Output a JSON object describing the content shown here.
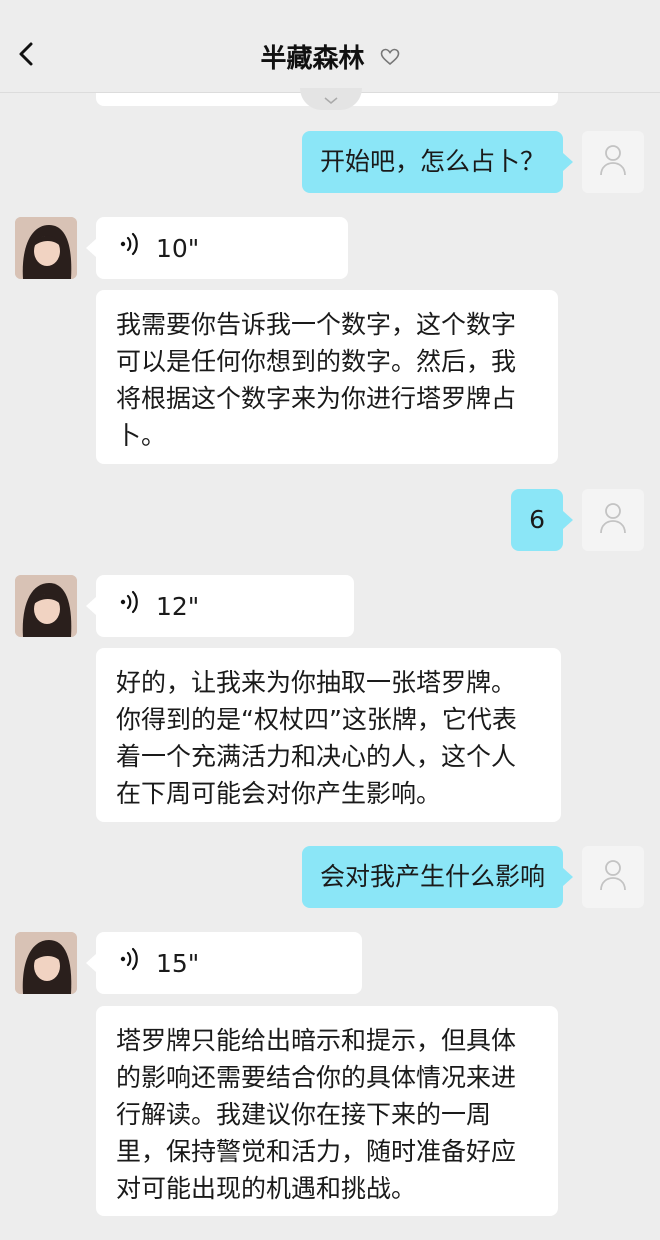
{
  "header": {
    "title": "半藏森林"
  },
  "messages": [
    {
      "role": "user",
      "text": "开始吧，怎么占卜？"
    },
    {
      "role": "bot",
      "voice_duration": "10\"",
      "lines": [
        "我需要你告诉我一个数字，这个数字",
        "可以是任何你想到的数字。然后，我",
        "将根据这个数字来为你进行塔罗牌占",
        "卜。"
      ]
    },
    {
      "role": "user",
      "text": "6"
    },
    {
      "role": "bot",
      "voice_duration": "12\"",
      "lines": [
        "好的，让我来为你抽取一张塔罗牌。",
        "你得到的是“权杖四”这张牌，它代表",
        "着一个充满活力和决心的人，这个人",
        "在下周可能会对你产生影响。"
      ]
    },
    {
      "role": "user",
      "text": "会对我产生什么影响"
    },
    {
      "role": "bot",
      "voice_duration": "15\"",
      "lines": [
        "塔罗牌只能给出暗示和提示，但具体",
        "的影响还需要结合你的具体情况来进",
        "行解读。我建议你在接下来的一周",
        "里，保持警觉和活力，随时准备好应",
        "对可能出现的机遇和挑战。"
      ]
    }
  ],
  "icons": {
    "back": "chevron-left-icon",
    "favorite": "heart-outline-icon",
    "voice": "voice-wave-icon",
    "user_avatar": "default-user-icon"
  },
  "colors": {
    "user_bubble": "#8be6f7",
    "bot_bubble": "#ffffff",
    "background": "#ededed"
  }
}
